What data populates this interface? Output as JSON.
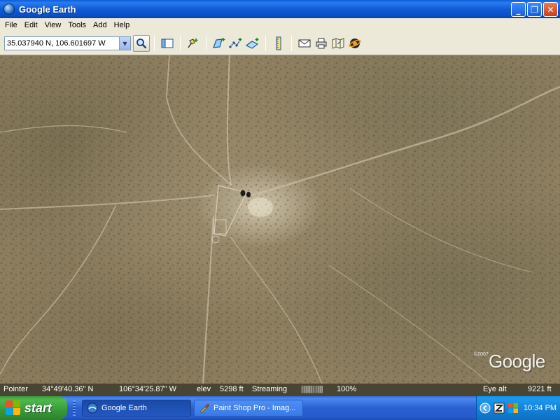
{
  "window": {
    "title": "Google Earth",
    "controls": {
      "minimize": "_",
      "restore": "❐",
      "close": "✕"
    }
  },
  "menu": {
    "items": [
      "File",
      "Edit",
      "View",
      "Tools",
      "Add",
      "Help"
    ]
  },
  "toolbar": {
    "search_value": "35.037940 N, 106.601697 W",
    "icons": [
      "search-icon",
      "sidebar-toggle-icon",
      "placemark-icon",
      "polygon-icon",
      "path-icon",
      "image-overlay-icon",
      "ruler-icon",
      "email-icon",
      "print-icon",
      "google-maps-icon",
      "sky-icon"
    ]
  },
  "map": {
    "watermark": "Google",
    "copyright": "©2007"
  },
  "statusbar": {
    "pointer_label": "Pointer",
    "lat": "34°49'40.36\" N",
    "lon": "106°34'25.87\" W",
    "elev_label": "elev",
    "elev_value": "5298 ft",
    "streaming_label": "Streaming",
    "streaming_bar": "|||||||||||",
    "streaming_percent": "100%",
    "eye_alt_label": "Eye alt",
    "eye_alt_value": "9221 ft"
  },
  "taskbar": {
    "start_label": "start",
    "tasks": [
      {
        "label": "Google Earth",
        "active": true
      },
      {
        "label": "Paint Shop Pro - Imag...",
        "active": false
      }
    ],
    "clock": "10:34 PM"
  }
}
